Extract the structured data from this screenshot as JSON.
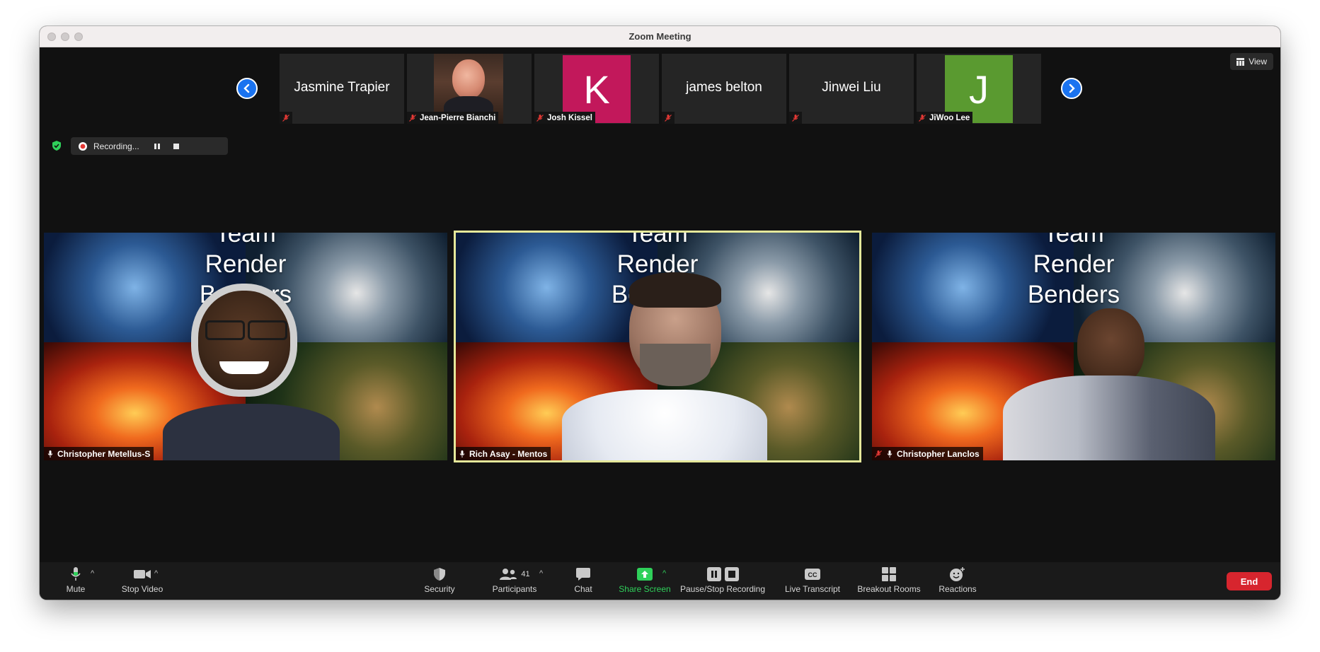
{
  "window": {
    "title": "Zoom Meeting"
  },
  "view_button": {
    "label": "View"
  },
  "gallery_strip": [
    {
      "name": "Jasmine Trapier",
      "display": "text",
      "label": ""
    },
    {
      "name": "Jean-Pierre Bianchi",
      "display": "photo",
      "label": "Jean-Pierre Bianchi"
    },
    {
      "name": "Josh Kissel",
      "display": "initial",
      "initial": "K",
      "color": "#c2185b",
      "label": "Josh Kissel"
    },
    {
      "name": "james belton",
      "display": "text",
      "label": ""
    },
    {
      "name": "Jinwei Liu",
      "display": "text",
      "label": ""
    },
    {
      "name": "JiWoo Lee",
      "display": "initial",
      "initial": "J",
      "color": "#5a9a30",
      "label": "JiWoo Lee"
    }
  ],
  "recording": {
    "status": "Recording..."
  },
  "main_tiles": [
    {
      "name": "Christopher Metellus-S",
      "background_text": [
        "Team",
        "Render",
        "Benders"
      ],
      "active": false
    },
    {
      "name": "Rich Asay - Mentos",
      "background_text": [
        "Team",
        "Render",
        "Benders"
      ],
      "active": true
    },
    {
      "name": "Christopher Lanclos",
      "background_text": [
        "Team",
        "Render",
        "Benders"
      ],
      "active": false
    }
  ],
  "toolbar": {
    "mute": "Mute",
    "stop_video": "Stop Video",
    "security": "Security",
    "participants": "Participants",
    "participants_count": "41",
    "chat": "Chat",
    "share_screen": "Share Screen",
    "pause_stop_recording": "Pause/Stop Recording",
    "live_transcript": "Live Transcript",
    "breakout_rooms": "Breakout Rooms",
    "reactions": "Reactions",
    "end": "End"
  },
  "colors": {
    "accent_blue": "#1a73f0",
    "share_green": "#2fd05a",
    "end_red": "#d7252e",
    "active_speaker": "#e5e89a"
  }
}
